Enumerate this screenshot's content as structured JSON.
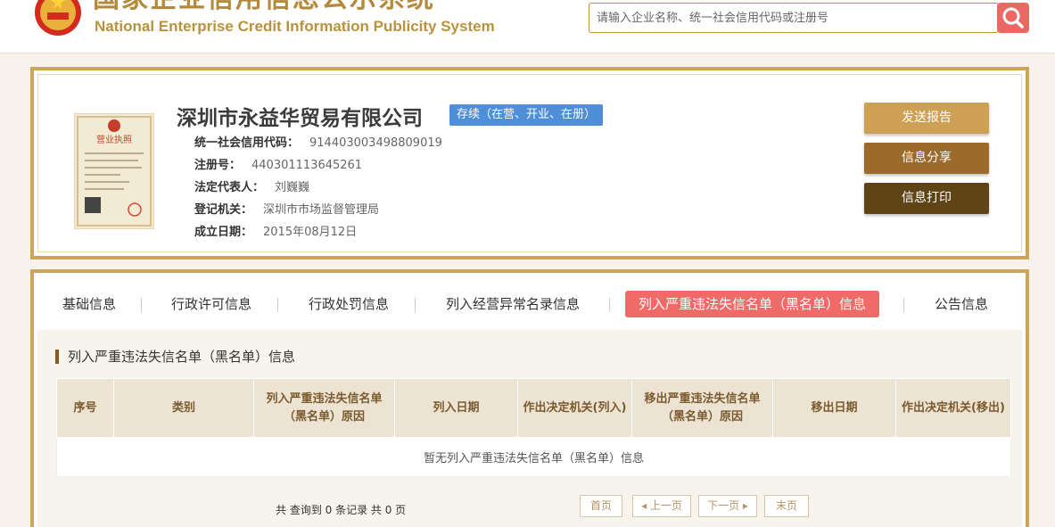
{
  "header": {
    "title_cn": "国家企业信用信息公示系统",
    "title_en": "National Enterprise Credit Information Publicity System",
    "search_placeholder": "请输入企业名称、统一社会信用代码或注册号",
    "search_icon": "search-icon",
    "emblem_icon": "national-emblem-icon"
  },
  "company": {
    "name": "深圳市永益华贸易有限公司",
    "status": "存续（在营、开业、在册）",
    "license_title": "营业执照",
    "fields": [
      {
        "label": "统一社会信用代码：",
        "value": "914403003498809019"
      },
      {
        "label": "注册号：",
        "value": "440301113645261"
      },
      {
        "label": "法定代表人：",
        "value": "刘巍巍"
      },
      {
        "label": "登记机关：",
        "value": "深圳市市场监督管理局"
      },
      {
        "label": "成立日期：",
        "value": "2015年08月12日"
      }
    ],
    "buttons": {
      "report": "发送报告",
      "share": "信息分享",
      "print": "信息打印"
    }
  },
  "tabs": [
    {
      "label": "基础信息"
    },
    {
      "label": "行政许可信息"
    },
    {
      "label": "行政处罚信息"
    },
    {
      "label": "列入经营异常名录信息"
    },
    {
      "label": "列入严重违法失信名单（黑名单）信息",
      "active": true
    },
    {
      "label": "公告信息"
    }
  ],
  "section": {
    "title": "列入严重违法失信名单（黑名单）信息",
    "columns": [
      "序号",
      "类别",
      "列入严重违法失信名单（黑名单）原因",
      "列入日期",
      "作出决定机关(列入)",
      "移出严重违法失信名单（黑名单）原因",
      "移出日期",
      "作出决定机关(移出)"
    ],
    "empty_text": "暂无列入严重违法失信名单（黑名单）信息"
  },
  "pager": {
    "summary": "共 查询到 0 条记录 共 0 页",
    "first": "首页",
    "prev": "◂ 上一页",
    "next": "下一页 ▸",
    "last": "末页"
  },
  "colors": {
    "gold": "#cda45c",
    "active_tab": "#f06a68",
    "status_badge": "#4e8fd8"
  }
}
